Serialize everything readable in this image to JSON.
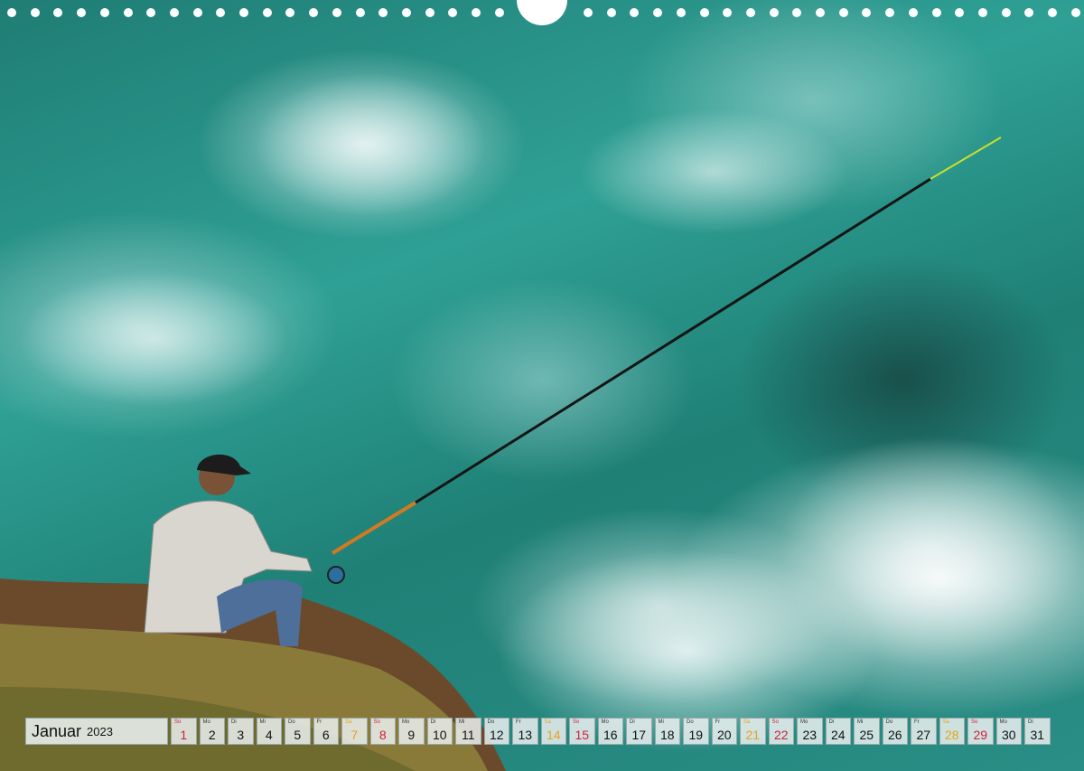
{
  "calendar": {
    "month": "Januar",
    "year": "2023",
    "days": [
      {
        "wd": "So",
        "num": "1",
        "kind": "sun"
      },
      {
        "wd": "Mo",
        "num": "2",
        "kind": "week"
      },
      {
        "wd": "Di",
        "num": "3",
        "kind": "week"
      },
      {
        "wd": "Mi",
        "num": "4",
        "kind": "week"
      },
      {
        "wd": "Do",
        "num": "5",
        "kind": "week"
      },
      {
        "wd": "Fr",
        "num": "6",
        "kind": "week"
      },
      {
        "wd": "Sa",
        "num": "7",
        "kind": "sat"
      },
      {
        "wd": "So",
        "num": "8",
        "kind": "sun"
      },
      {
        "wd": "Mo",
        "num": "9",
        "kind": "week"
      },
      {
        "wd": "Di",
        "num": "10",
        "kind": "week"
      },
      {
        "wd": "Mi",
        "num": "11",
        "kind": "week"
      },
      {
        "wd": "Do",
        "num": "12",
        "kind": "week"
      },
      {
        "wd": "Fr",
        "num": "13",
        "kind": "week"
      },
      {
        "wd": "Sa",
        "num": "14",
        "kind": "sat"
      },
      {
        "wd": "So",
        "num": "15",
        "kind": "sun"
      },
      {
        "wd": "Mo",
        "num": "16",
        "kind": "week"
      },
      {
        "wd": "Di",
        "num": "17",
        "kind": "week"
      },
      {
        "wd": "Mi",
        "num": "18",
        "kind": "week"
      },
      {
        "wd": "Do",
        "num": "19",
        "kind": "week"
      },
      {
        "wd": "Fr",
        "num": "20",
        "kind": "week"
      },
      {
        "wd": "Sa",
        "num": "21",
        "kind": "sat"
      },
      {
        "wd": "So",
        "num": "22",
        "kind": "sun"
      },
      {
        "wd": "Mo",
        "num": "23",
        "kind": "week"
      },
      {
        "wd": "Di",
        "num": "24",
        "kind": "week"
      },
      {
        "wd": "Mi",
        "num": "25",
        "kind": "week"
      },
      {
        "wd": "Do",
        "num": "26",
        "kind": "week"
      },
      {
        "wd": "Fr",
        "num": "27",
        "kind": "week"
      },
      {
        "wd": "Sa",
        "num": "28",
        "kind": "sat"
      },
      {
        "wd": "So",
        "num": "29",
        "kind": "sun"
      },
      {
        "wd": "Mo",
        "num": "30",
        "kind": "week"
      },
      {
        "wd": "Di",
        "num": "31",
        "kind": "week"
      }
    ]
  },
  "colors": {
    "saturday": "#e8a21a",
    "sunday": "#d0203a",
    "sea": "#2a8e86"
  }
}
